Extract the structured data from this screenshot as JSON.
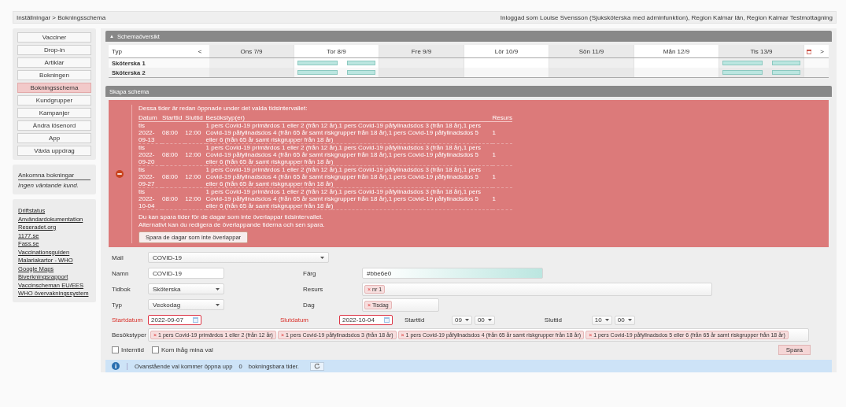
{
  "breadcrumb": "Inställningar > Bokningsschema",
  "login_info": "Inloggad som Louise Svensson (Sjuksköterska med adminfunktion), Region Kalmar län, Region Kalmar Testmottagning",
  "sidebar": {
    "menu": [
      {
        "label": "Vacciner",
        "selected": false
      },
      {
        "label": "Drop-in",
        "selected": false
      },
      {
        "label": "Artiklar",
        "selected": false
      },
      {
        "label": "Bokningen",
        "selected": false
      },
      {
        "label": "Bokningsschema",
        "selected": true
      },
      {
        "label": "Kundgrupper",
        "selected": false
      },
      {
        "label": "Kampanjer",
        "selected": false
      },
      {
        "label": "Ändra lösenord",
        "selected": false
      },
      {
        "label": "App",
        "selected": false
      },
      {
        "label": "Växla uppdrag",
        "selected": false
      }
    ],
    "arrivals": {
      "title": "Ankomna bokningar",
      "text": "Ingen väntande kund."
    },
    "links": [
      "Driftstatus",
      "Användardokumentation",
      "Reseradet.org",
      "1177.se",
      "Fass.se",
      "Vaccinationsguiden",
      "Malariakartor - WHO",
      "Google Maps",
      "Biverkningsrapport",
      "Vaccinscheman EU/EES",
      "WHO övervakningssystem"
    ]
  },
  "overview": {
    "title": "Schemaöversikt",
    "expand_icon": "▲",
    "type_header": "Typ",
    "prev": "<",
    "next": ">",
    "days": [
      "Ons 7/9",
      "Tor 8/9",
      "Fre 9/9",
      "Lör 10/9",
      "Sön 11/9",
      "Mån 12/9",
      "Tis 13/9"
    ],
    "rows": [
      {
        "name": "Sköterska 1",
        "cells": [
          {
            "open": false
          },
          {
            "open": true
          },
          {
            "open": false
          },
          {
            "open": false
          },
          {
            "open": false
          },
          {
            "open": false
          },
          {
            "open": true
          }
        ]
      },
      {
        "name": "Sköterska 2",
        "cells": [
          {
            "open": false
          },
          {
            "open": true
          },
          {
            "open": false
          },
          {
            "open": false
          },
          {
            "open": false
          },
          {
            "open": false
          },
          {
            "open": true
          }
        ]
      }
    ]
  },
  "create": {
    "title": "Skapa schema",
    "conflict": {
      "intro": "Dessa tider är redan öppnade under det valda tidsintervallet:",
      "columns": [
        "Datum",
        "Starttid",
        "Sluttid",
        "Besökstyp(er)",
        "Resurs"
      ],
      "rows": [
        {
          "date": "tis 2022-09-13",
          "start": "08:00",
          "end": "12:00",
          "types": "1 pers Covid-19 primärdos 1 eller 2 (från 12 år),1 pers Covid-19 påfyllnadsdos 3 (från 18 år),1 pers Covid-19 påfyllnadsdos 4 (från 65 år samt riskgrupper från 18 år),1 pers Covid-19 påfyllnadsdos 5 eller 6 (från 65 år samt riskgrupper från 18 år)",
          "resource": "1"
        },
        {
          "date": "tis 2022-09-20",
          "start": "08:00",
          "end": "12:00",
          "types": "1 pers Covid-19 primärdos 1 eller 2 (från 12 år),1 pers Covid-19 påfyllnadsdos 3 (från 18 år),1 pers Covid-19 påfyllnadsdos 4 (från 65 år samt riskgrupper från 18 år),1 pers Covid-19 påfyllnadsdos 5 eller 6 (från 65 år samt riskgrupper från 18 år)",
          "resource": "1"
        },
        {
          "date": "tis 2022-09-27",
          "start": "08:00",
          "end": "12:00",
          "types": "1 pers Covid-19 primärdos 1 eller 2 (från 12 år),1 pers Covid-19 påfyllnadsdos 3 (från 18 år),1 pers Covid-19 påfyllnadsdos 4 (från 65 år samt riskgrupper från 18 år),1 pers Covid-19 påfyllnadsdos 5 eller 6 (från 65 år samt riskgrupper från 18 år)",
          "resource": "1"
        },
        {
          "date": "tis 2022-10-04",
          "start": "08:00",
          "end": "12:00",
          "types": "1 pers Covid-19 primärdos 1 eller 2 (från 12 år),1 pers Covid-19 påfyllnadsdos 3 (från 18 år),1 pers Covid-19 påfyllnadsdos 4 (från 65 år samt riskgrupper från 18 år),1 pers Covid-19 påfyllnadsdos 5 eller 6 (från 65 år samt riskgrupper från 18 år)",
          "resource": "1"
        }
      ],
      "footer": [
        "Du kan spara tider för de dagar som inte överlappar tidsintervallet.",
        "Alternativt kan du redigera de överlappande tiderna och sen spara."
      ],
      "button": "Spara de dagar som inte överlappar"
    },
    "template": {
      "label": "Mall",
      "value": "COVID-19"
    },
    "name": {
      "label": "Namn",
      "value": "COVID-19"
    },
    "color": {
      "label": "Färg",
      "value": "#bbe6e0"
    },
    "calendar": {
      "label": "Tidbok",
      "value": "Sköterska"
    },
    "resource": {
      "label": "Resurs",
      "tags": [
        "nr 1"
      ]
    },
    "type": {
      "label": "Typ",
      "value": "Veckodag"
    },
    "day": {
      "label": "Dag",
      "tags": [
        "Tisdag"
      ]
    },
    "start_date": {
      "label": "Startdatum",
      "value": "2022-09-07",
      "error": true
    },
    "end_date": {
      "label": "Slutdatum",
      "value": "2022-10-04",
      "error": true
    },
    "start_time": {
      "label": "Starttid",
      "hour": "09",
      "minute": "00"
    },
    "end_time": {
      "label": "Sluttid",
      "hour": "10",
      "minute": "00"
    },
    "visit_types": {
      "label": "Besökstyper",
      "tags": [
        "1 pers Covid-19 primärdos 1 eller 2 (från 12 år)",
        "1 pers Covid-19 påfyllnadsdos 3 (från 18 år)",
        "1 pers Covid-19 påfyllnadsdos 4 (från 65 år samt riskgrupper från 18 år)",
        "1 pers Covid-19 påfyllnadsdos 5 eller 6 (från 65 år samt riskgrupper från 18 år)"
      ]
    },
    "checkboxes": [
      {
        "label": "Interntid",
        "checked": false
      },
      {
        "label": "Kom ihåg mina val",
        "checked": false
      }
    ],
    "tag_remove": "×",
    "save": "Spara",
    "info": {
      "before": "Ovanstående val kommer öppna upp",
      "count": "0",
      "after": "bokningsbara tider."
    }
  }
}
